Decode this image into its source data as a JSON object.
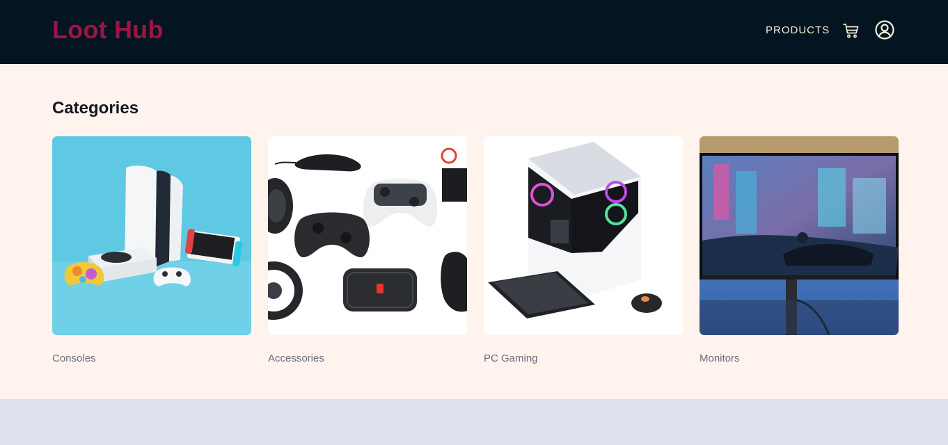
{
  "header": {
    "brand": "Loot Hub",
    "nav": {
      "products_label": "PRODUCTS"
    },
    "icons": [
      "cart-icon",
      "account-icon"
    ]
  },
  "colors": {
    "header_bg": "#051421",
    "brand": "#9c1547",
    "nav_text": "#f4efd6",
    "page_bg": "#fff3ee",
    "footer_bg": "#dde1ec"
  },
  "categories": {
    "title": "Categories",
    "items": [
      {
        "label": "Consoles",
        "image": "consoles-photo"
      },
      {
        "label": "Accessories",
        "image": "accessories-photo"
      },
      {
        "label": "PC Gaming",
        "image": "pc-gaming-photo"
      },
      {
        "label": "Monitors",
        "image": "monitors-photo"
      }
    ]
  }
}
